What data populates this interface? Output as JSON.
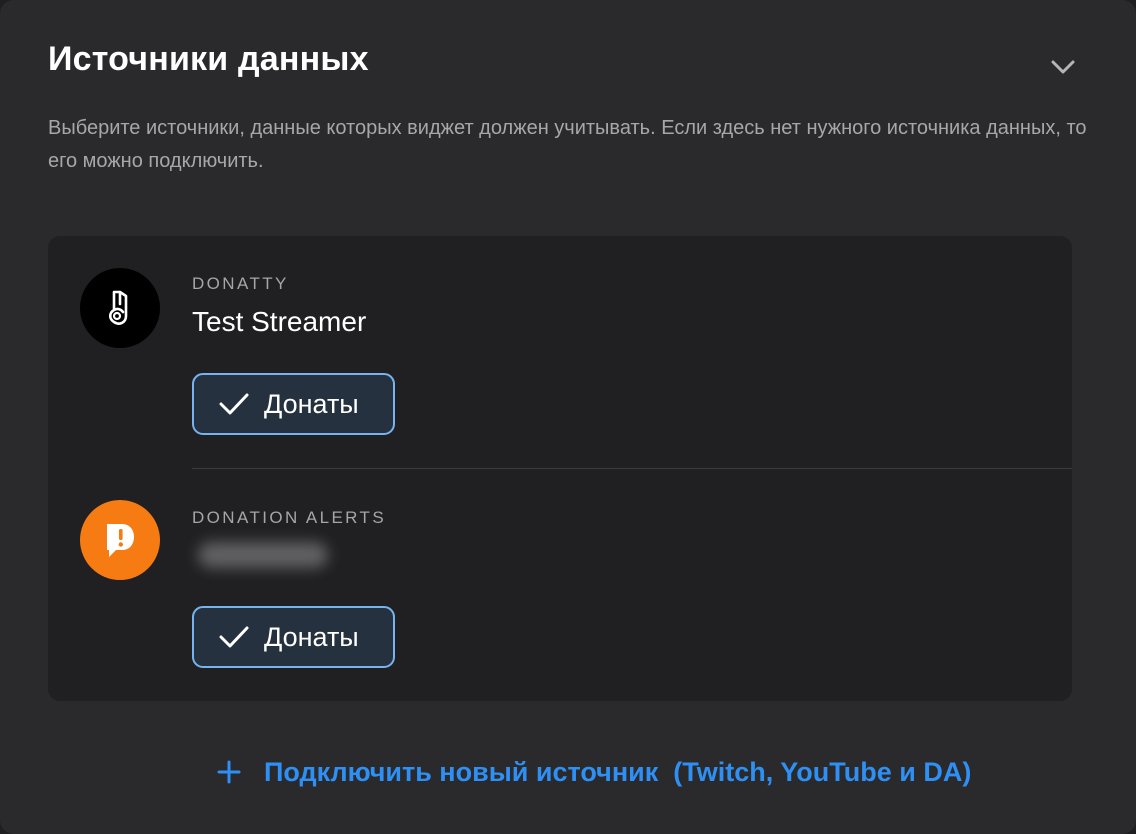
{
  "section": {
    "title": "Источники данных",
    "description": "Выберите источники, данные которых виджет должен учитывать. Если здесь нет нужного источника данных, то его можно подключить."
  },
  "sources": [
    {
      "service": "DONATTY",
      "account": "Test Streamer",
      "chip_label": "Донаты",
      "checked": true,
      "logo_icon": "donatty-logo-icon",
      "logo_color": "#000000"
    },
    {
      "service": "DONATION ALERTS",
      "account": "",
      "account_blurred": true,
      "chip_label": "Донаты",
      "checked": true,
      "logo_icon": "donationalerts-logo-icon",
      "logo_color": "#f57b12"
    }
  ],
  "connect": {
    "label": "Подключить новый источник  (Twitch, YouTube и DA)",
    "icon": "plus-icon",
    "color": "#2e8ff4"
  },
  "colors": {
    "chip_border": "#76b3ef",
    "chip_background": "#26313f",
    "card_background": "#202022",
    "panel_background": "#2a2a2c"
  }
}
